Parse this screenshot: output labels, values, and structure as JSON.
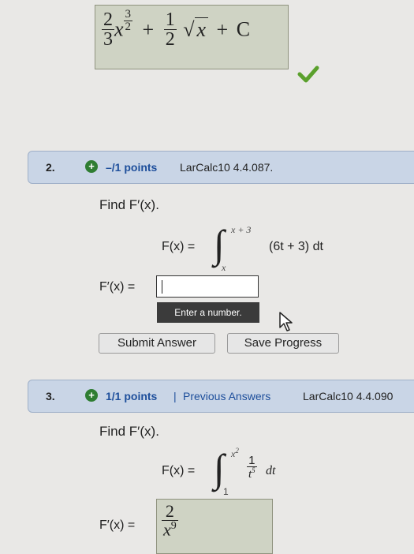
{
  "q1": {
    "answer": {
      "t1_num": "2",
      "t1_den": "3",
      "t1_var": "x",
      "t1_exp_num": "3",
      "t1_exp_den": "2",
      "plus1": "+",
      "t2_num": "1",
      "t2_den": "2",
      "t2_radicand": "x",
      "plus2": "+",
      "const": "C"
    }
  },
  "q2": {
    "number": "2.",
    "points": "–/1 points",
    "source": "LarCalc10 4.4.087.",
    "prompt": "Find F′(x).",
    "fx": "F(x) =",
    "upper": "x + 3",
    "lower": "x",
    "integrand": "(6t + 3) dt",
    "answer_label": "F′(x) =",
    "input_value": "",
    "tooltip": "Enter a number.",
    "submit": "Submit Answer",
    "save": "Save Progress"
  },
  "q3": {
    "number": "3.",
    "points": "1/1 points",
    "separator": "|",
    "previous": "Previous Answers",
    "source": "LarCalc10 4.4.090",
    "prompt": "Find F′(x).",
    "fx": "F(x) =",
    "upper_base": "x",
    "upper_exp": "2",
    "lower": "1",
    "int_num": "1",
    "int_den_base": "t",
    "int_den_exp": "5",
    "dt": "dt",
    "answer_label": "F′(x) =",
    "ans_num": "2",
    "ans_den_base": "x",
    "ans_den_exp": "9"
  },
  "colors": {
    "header_bg": "#c9d5e6",
    "link": "#1d4e9b",
    "check": "#5aa02c",
    "answer_box": "#cfd3c4"
  }
}
